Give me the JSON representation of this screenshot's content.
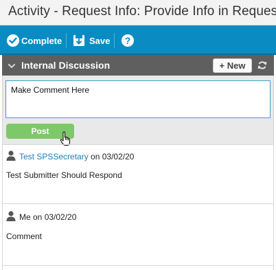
{
  "window": {
    "title": "Activity - Request Info: Provide Info in Request"
  },
  "toolbar": {
    "complete_label": "Complete",
    "save_label": "Save",
    "help_icon": "question-circle-icon",
    "accent": "#0a8cc3"
  },
  "panel": {
    "title": "Internal Discussion",
    "new_label": "+ New",
    "header_color": "#5f5f5f"
  },
  "comment_box": {
    "value": "Make Comment Here",
    "post_label": "Post",
    "post_color": "#7ec86a"
  },
  "comments": [
    {
      "author": "Test SPSSecretary",
      "date_text": " on 03/02/20",
      "text": "Test Submitter Should Respond"
    },
    {
      "author": "Me",
      "date_text": " on 03/02/20",
      "text": "Comment"
    }
  ]
}
